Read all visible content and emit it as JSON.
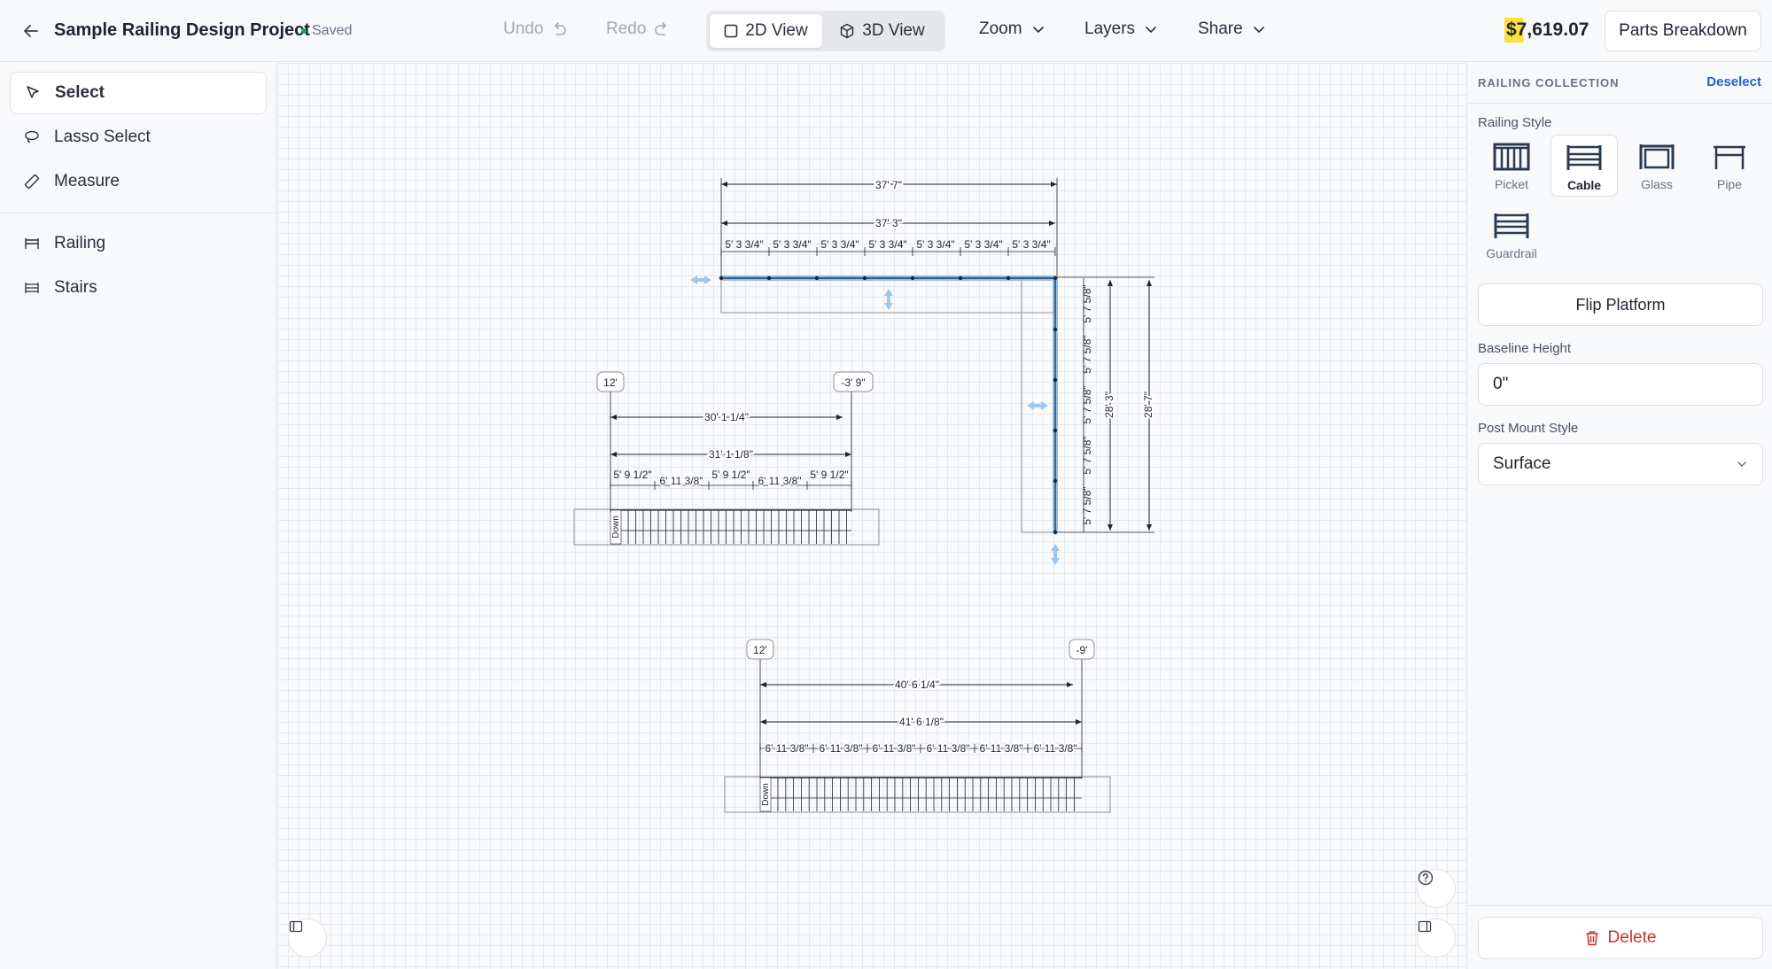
{
  "header": {
    "project_title": "Sample Railing Design Project",
    "saved_status": "Saved",
    "undo_label": "Undo",
    "redo_label": "Redo",
    "view_2d_label": "2D View",
    "view_3d_label": "3D View",
    "active_view": "2D View",
    "zoom_label": "Zoom",
    "layers_label": "Layers",
    "share_label": "Share",
    "price": "$7,619.07",
    "parts_breakdown_label": "Parts Breakdown"
  },
  "sidebar": {
    "tools": [
      {
        "label": "Select",
        "icon": "cursor-icon",
        "active": true
      },
      {
        "label": "Lasso Select",
        "icon": "lasso-icon",
        "active": false
      },
      {
        "label": "Measure",
        "icon": "ruler-icon",
        "active": false
      }
    ],
    "elements": [
      {
        "label": "Railing",
        "icon": "railing-icon"
      },
      {
        "label": "Stairs",
        "icon": "stairs-icon"
      }
    ]
  },
  "canvas": {
    "railing_l": {
      "top_total": "37' 7\"",
      "top_inner": "37' 3\"",
      "top_segments": [
        "5' 3 3/4\"",
        "5' 3 3/4\"",
        "5' 3 3/4\"",
        "5' 3 3/4\"",
        "5' 3 3/4\"",
        "5' 3 3/4\"",
        "5' 3 3/4\""
      ],
      "right_segments": [
        "5' 7 5/8\"",
        "5' 7 5/8\"",
        "5' 7 5/8\"",
        "5' 7 5/8\"",
        "5' 7 5/8\""
      ],
      "right_inner": "28' 3\"",
      "right_total": "28' 7\""
    },
    "stairs_1": {
      "start_height": "12'",
      "end_height": "-3' 9\"",
      "run": "30' 1 1/4\"",
      "length": "31' 1 1/8\"",
      "segments": [
        "5' 9 1/2\"",
        "6' 11 3/8\"",
        "5' 9 1/2\"",
        "6' 11 3/8\"",
        "5' 9 1/2\""
      ],
      "direction": "Down"
    },
    "stairs_2": {
      "start_height": "12'",
      "end_height": "-9'",
      "run": "40' 6 1/4\"",
      "length": "41' 6 1/8\"",
      "segments": [
        "6' 11 3/8\"",
        "6' 11 3/8\"",
        "6' 11 3/8\"",
        "6' 11 3/8\"",
        "6' 11 3/8\"",
        "6' 11 3/8\""
      ],
      "direction": "Down"
    }
  },
  "panel": {
    "title": "RAILING COLLECTION",
    "deselect_label": "Deselect",
    "railing_style_label": "Railing Style",
    "styles": [
      {
        "label": "Picket",
        "icon": "picket-railing-icon",
        "active": false
      },
      {
        "label": "Cable",
        "icon": "cable-railing-icon",
        "active": true
      },
      {
        "label": "Glass",
        "icon": "glass-railing-icon",
        "active": false
      },
      {
        "label": "Pipe",
        "icon": "pipe-railing-icon",
        "active": false
      },
      {
        "label": "Guardrail",
        "icon": "guardrail-icon",
        "active": false
      }
    ],
    "flip_platform_label": "Flip Platform",
    "baseline_height_label": "Baseline Height",
    "baseline_height_value": "0\"",
    "post_mount_style_label": "Post Mount Style",
    "post_mount_style_value": "Surface",
    "delete_label": "Delete"
  },
  "colors": {
    "selection_blue": "#7fb8ea",
    "price_highlight": "#ffd600",
    "delete_red": "#c53030",
    "link_blue": "#2563c9"
  }
}
